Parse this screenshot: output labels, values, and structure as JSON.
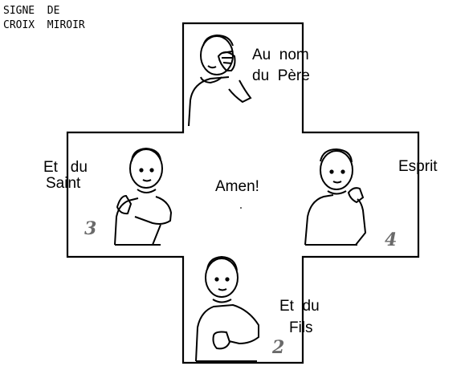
{
  "heading": {
    "line1": "SIGNE  DE",
    "line2": "CROIX  MIROIR"
  },
  "panels": {
    "top": {
      "line1": "Au  nom",
      "line2": "du  Père"
    },
    "left": {
      "line1": "Et   du",
      "line2": "Saint",
      "number": "3"
    },
    "center": {
      "text": "Amen!"
    },
    "right": {
      "line1": "Esprit",
      "number": "4"
    },
    "bottom": {
      "line1": "Et  du",
      "line2": "Fils",
      "number": "2"
    }
  }
}
